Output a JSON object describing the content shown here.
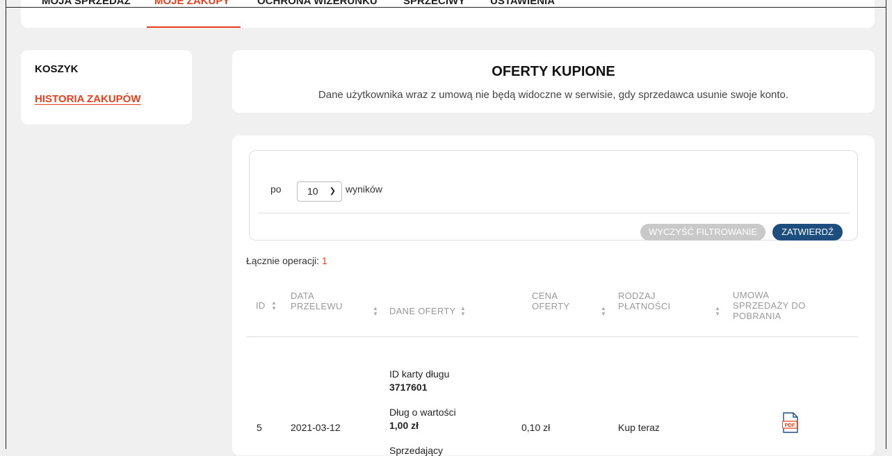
{
  "topnav": {
    "items": [
      {
        "label": "MOJA SPRZEDAŻ"
      },
      {
        "label": "MOJE ZAKUPY"
      },
      {
        "label": "OCHRONA WIZERUNKU"
      },
      {
        "label": "SPRZECIWY"
      },
      {
        "label": "USTAWIENIA"
      }
    ],
    "active_index": 1
  },
  "sidebar": {
    "items": [
      {
        "label": "KOSZYK"
      },
      {
        "label": "HISTORIA ZAKUPÓW"
      }
    ]
  },
  "header": {
    "title": "OFERTY KUPIONE",
    "subtitle": "Dane użytkownika wraz z umową nie będą widoczne w serwisie, gdy sprzedawca usunie swoje konto."
  },
  "filter": {
    "per_page_prefix": "po",
    "per_page_value": "10",
    "per_page_suffix": "wyników",
    "clear_label": "WYCZYŚĆ FILTROWANIE",
    "confirm_label": "ZATWIERDŹ"
  },
  "summary": {
    "label": "Łącznie operacji:",
    "count": "1"
  },
  "table": {
    "columns": [
      {
        "line1": "ID",
        "line2": ""
      },
      {
        "line1": "DATA",
        "line2": "PRZELEWU"
      },
      {
        "line1": "DANE OFERTY",
        "line2": ""
      },
      {
        "line1": "CENA",
        "line2": "OFERTY"
      },
      {
        "line1": "RODZAJ",
        "line2": "PŁATNOŚCI"
      },
      {
        "line1": "UMOWA",
        "line2": "SPRZEDAŻY DO",
        "line3": "POBRANIA"
      }
    ],
    "rows": [
      {
        "id": "5",
        "date": "2021-03-12",
        "offer": {
          "card_label": "ID karty długu",
          "card_value": "3717601",
          "debt_label": "Dług o wartości",
          "debt_value": "1,00 zł",
          "seller_label": "Sprzedający"
        },
        "price": "0,10 zł",
        "payment": "Kup teraz",
        "contract_icon": "pdf-icon"
      }
    ]
  },
  "colors": {
    "accent": "#e8401c",
    "primary_button": "#1e4e7d",
    "disabled_button": "#c9c9c9"
  }
}
